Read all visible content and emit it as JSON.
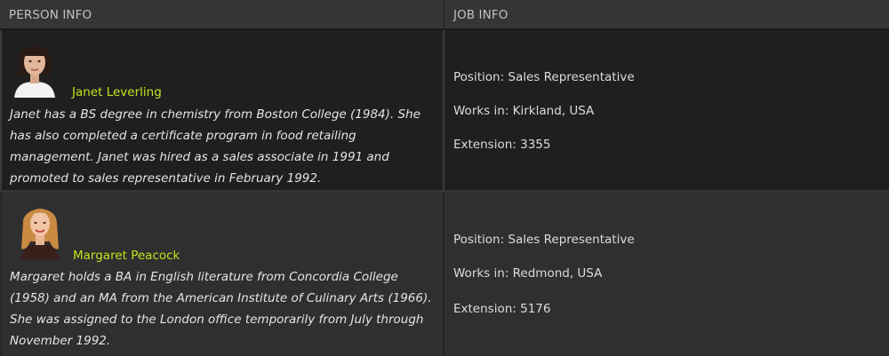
{
  "headers": {
    "person": "PERSON INFO",
    "job": "JOB INFO"
  },
  "colors": {
    "name_accent": "#c6e01c",
    "header_bg": "#353535",
    "row_odd_bg": "#1f1f1f",
    "row_even_bg": "#2f2f2f"
  },
  "rows": [
    {
      "name": "Janet Leverling",
      "avatar_icon": "portrait-photo-janet",
      "bio": "Janet has a BS degree in chemistry from Boston College (1984). She has also completed a certificate program in food retailing management. Janet was hired as a sales associate in 1991 and promoted to sales representative in February 1992.",
      "position": "Position: Sales Representative",
      "works_in": "Works in: Kirkland, USA",
      "extension": "Extension: 3355"
    },
    {
      "name": "Margaret Peacock",
      "avatar_icon": "portrait-photo-margaret",
      "bio": "Margaret holds a BA in English literature from Concordia College (1958) and an MA from the American Institute of Culinary Arts (1966). She was assigned to the London office temporarily from July through November 1992.",
      "position": "Position: Sales Representative",
      "works_in": "Works in: Redmond, USA",
      "extension": "Extension: 5176"
    }
  ]
}
